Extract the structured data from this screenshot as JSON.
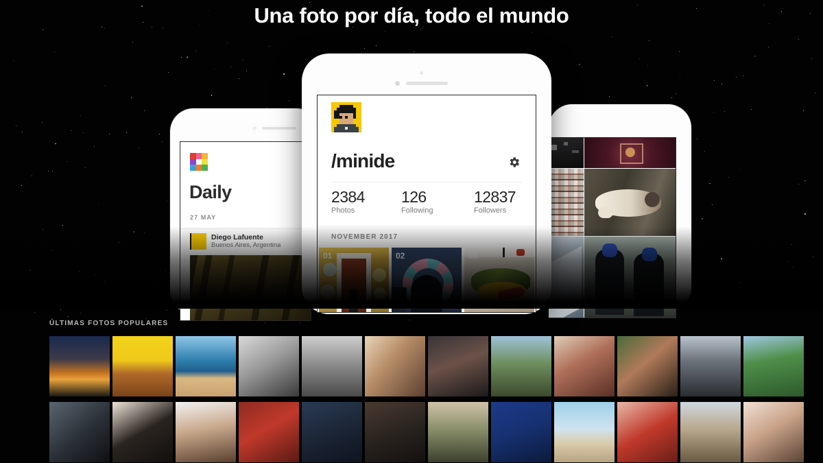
{
  "page": {
    "background_color": "#000000",
    "headline": "Una foto por día, todo el mundo"
  },
  "phone_left": {
    "app_name": "Daily",
    "logo_name": "daily-logo",
    "logo_colors": [
      "#e23b2e",
      "#f06292",
      "#f2b632",
      "#8e44d0",
      "#c8d63a",
      "#e8e23a",
      "#3aa0e0",
      "#f07e2a",
      "#4caf50"
    ],
    "date_label": "27 MAY",
    "user": {
      "name": "Diego Lafuente",
      "location": "Buenos Aires, Argentina"
    }
  },
  "phone_center": {
    "handle": "/minide",
    "settings_icon": "gear-icon",
    "avatar_name": "pixel-avatar",
    "stats": [
      {
        "value": "2384",
        "label": "Photos"
      },
      {
        "value": "126",
        "label": "Following"
      },
      {
        "value": "12837",
        "label": "Followers"
      }
    ],
    "month_label": "NOVEMBER 2017",
    "photos": [
      {
        "index": "01",
        "caption": "graffiti doorway"
      },
      {
        "index": "02",
        "caption": "ferris wheel silhouette"
      },
      {
        "index": "03",
        "caption": "street food"
      }
    ]
  },
  "phone_right": {
    "grid_caption": "photo-grid",
    "tiles": [
      "night street",
      "dark red portrait",
      "bookshelves",
      "cat on tree",
      "blue interior",
      "two riders"
    ]
  },
  "popular": {
    "section_label": "ÚLTIMAS FOTOS POPULARES",
    "columns": 12,
    "rows": 2,
    "thumbnails": [
      {
        "caption": "sunset lighthouse"
      },
      {
        "caption": "burger ad poster"
      },
      {
        "caption": "surfer on beach"
      },
      {
        "caption": "bw portrait sleeping"
      },
      {
        "caption": "bw palace square"
      },
      {
        "caption": "close-up eye"
      },
      {
        "caption": "two friends selfie"
      },
      {
        "caption": "coastal road"
      },
      {
        "caption": "mother and baby"
      },
      {
        "caption": "couple selfie"
      },
      {
        "caption": "quad bike rider"
      },
      {
        "caption": "road sign"
      },
      {
        "caption": "dark portrait"
      },
      {
        "caption": "curly hair selfie"
      },
      {
        "caption": "man in white tee"
      },
      {
        "caption": "protest banner"
      },
      {
        "caption": "man with sunglasses"
      },
      {
        "caption": "man with cap"
      },
      {
        "caption": "person on path"
      },
      {
        "caption": "blue jacket figure"
      },
      {
        "caption": "beach yoga"
      },
      {
        "caption": "boy in red shirt"
      },
      {
        "caption": "runner on road"
      },
      {
        "caption": "young man selfie"
      }
    ]
  }
}
